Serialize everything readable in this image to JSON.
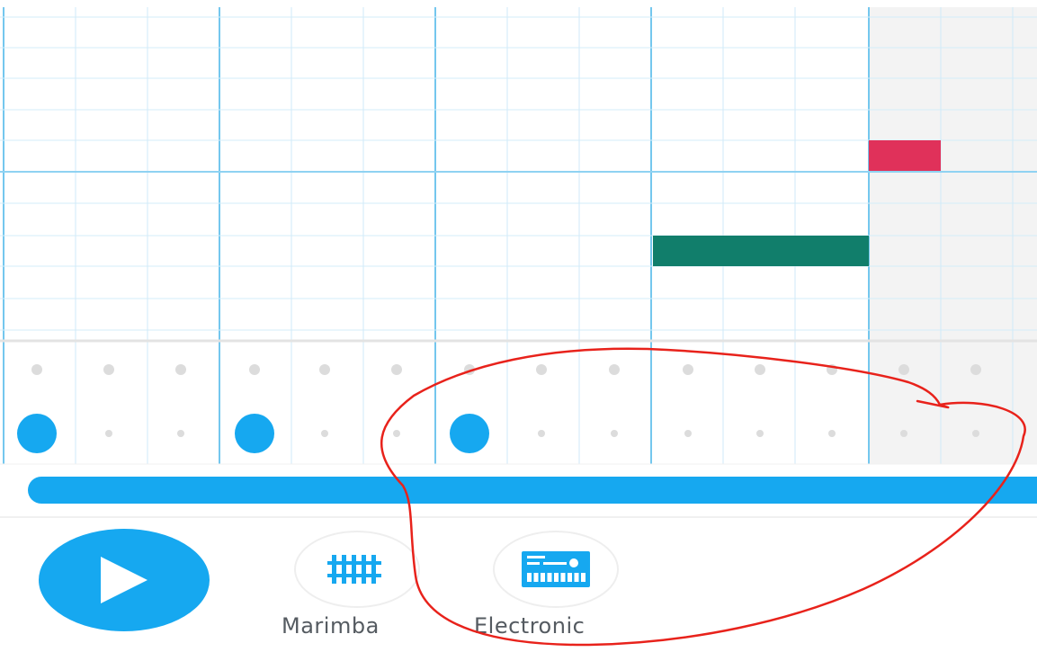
{
  "piano_roll": {
    "notes": [
      {
        "name": "note-green",
        "color": "#117e6b"
      },
      {
        "name": "note-red",
        "color": "#e0315a"
      }
    ]
  },
  "rhythm": {
    "active_color": "#16a8f0",
    "inactive_color": "#d6d6d6"
  },
  "progress": {
    "fraction": 1.0,
    "color": "#16a8f0"
  },
  "controls": {
    "play_icon": "play-icon",
    "instruments": [
      {
        "id": "marimba",
        "label": "Marimba",
        "icon": "marimba-icon"
      },
      {
        "id": "electronic",
        "label": "Electronic",
        "icon": "electronic-icon"
      }
    ]
  },
  "annotation": {
    "color": "#e8221b"
  }
}
